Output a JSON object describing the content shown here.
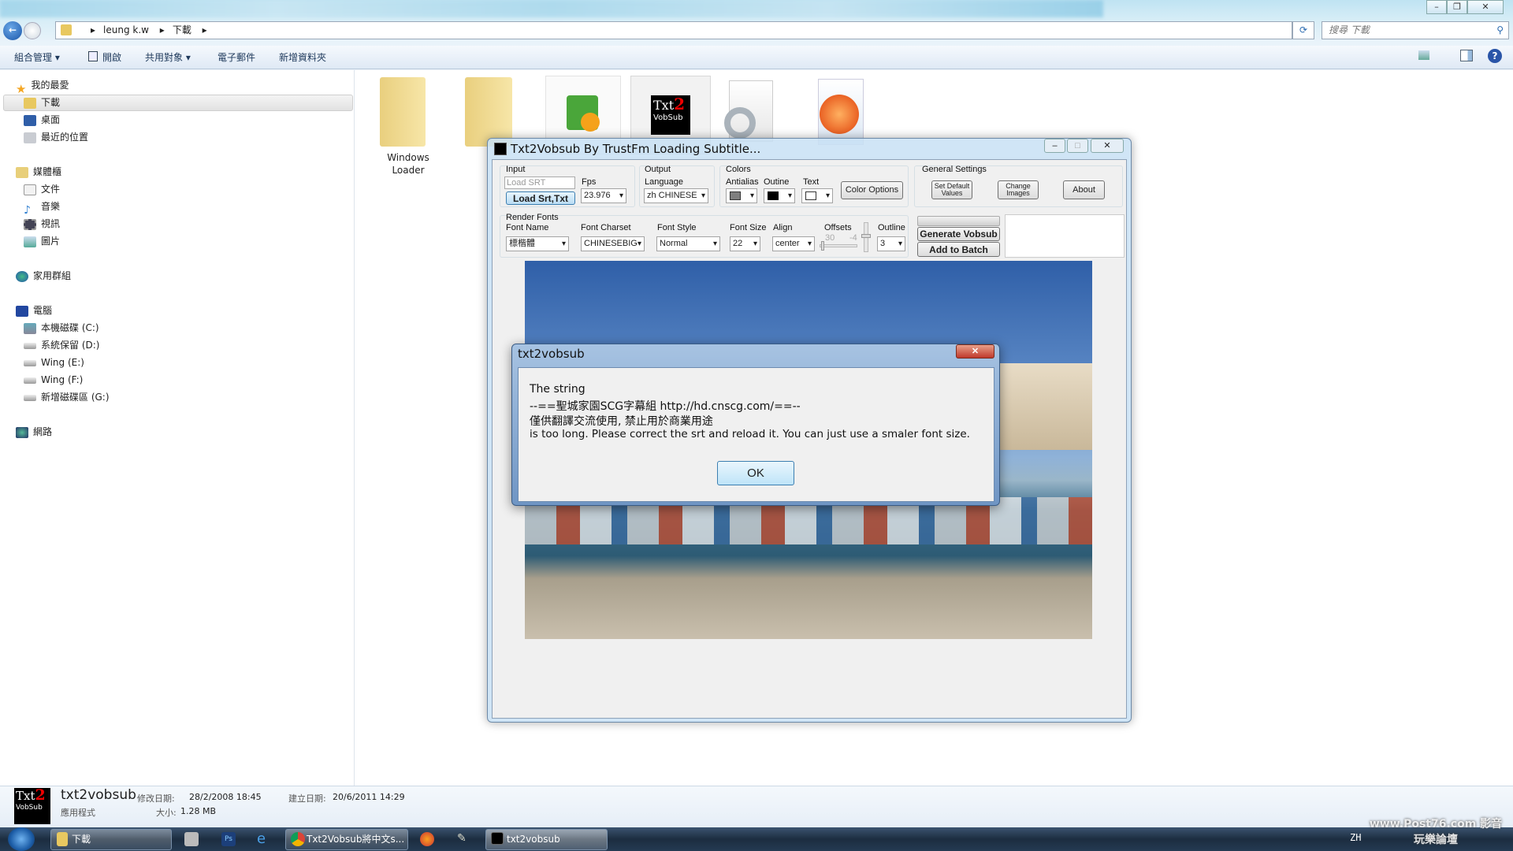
{
  "explorer": {
    "address": [
      "leung k.w",
      "下載"
    ],
    "search_placeholder": "搜尋 下載",
    "toolbar": [
      "組合管理 ▾",
      "開啟",
      "共用對象 ▾",
      "電子郵件",
      "新增資料夾"
    ],
    "sidebar": {
      "favorites": {
        "label": "我的最愛",
        "items": [
          "下載",
          "桌面",
          "最近的位置"
        ]
      },
      "libraries": {
        "label": "媒體櫃",
        "items": [
          "文件",
          "音樂",
          "視訊",
          "圖片"
        ]
      },
      "homegroup": "家用群組",
      "computer": {
        "label": "電腦",
        "items": [
          "本機磁碟 (C:)",
          "系統保留 (D:)",
          "Wing (E:)",
          "Wing (F:)",
          "新增磁碟區 (G:)"
        ]
      },
      "network": "網路"
    },
    "files": [
      {
        "label": "Windows Loader"
      }
    ],
    "details": {
      "name": "txt2vobsub",
      "type": "應用程式",
      "modified_label": "修改日期:",
      "modified": "28/2/2008 18:45",
      "created_label": "建立日期:",
      "created": "20/6/2011 14:29",
      "size_label": "大小:",
      "size": "1.28 MB"
    }
  },
  "app": {
    "title": "Txt2Vobsub By TrustFm Loading Subtitle...",
    "input": {
      "group": "Input",
      "srt_placeholder": "Load SRT",
      "load_button": "Load Srt,Txt",
      "fps_label": "Fps",
      "fps": "23.976"
    },
    "output": {
      "group": "Output",
      "language_label": "Language",
      "language": "zh CHINESE"
    },
    "colors": {
      "group": "Colors",
      "antialias": "Antialias",
      "outline": "Outine",
      "text": "Text",
      "color_options": "Color Options",
      "antialias_color": "#7f7f7f",
      "outline_color": "#000000",
      "text_color": "#ffffff"
    },
    "general": {
      "group": "General Settings",
      "set_default": "Set Default Values",
      "change_images": "Change Images",
      "about": "About"
    },
    "render": {
      "group": "Render Fonts",
      "font_name_label": "Font Name",
      "font_name": "標楷體",
      "charset_label": "Font Charset",
      "charset": "CHINESEBIG",
      "style_label": "Font Style",
      "style": "Normal",
      "size_label": "Font Size",
      "size": "22",
      "align_label": "Align",
      "align": "center",
      "offsets_label": "Offsets",
      "offset_x": "30",
      "offset_y": "-4",
      "outline_label": "Outline",
      "outline": "3"
    },
    "generate": "Generate Vobsub",
    "add_batch": "Add to Batch"
  },
  "dialog": {
    "title": "txt2vobsub",
    "lines": [
      "The string",
      "--==聖城家園SCG字幕組 http://hd.cnscg.com/==--",
      "僅供翻譯交流使用, 禁止用於商業用途",
      "is too long. Please correct the srt and reload it. You can just use a smaler font size."
    ],
    "ok": "OK"
  },
  "taskbar": {
    "explorer": "下載",
    "chrome": "Txt2Vobsub將中文s...",
    "app": "txt2vobsub",
    "lang": "ZH"
  },
  "watermark": "www.Post76.com 影音玩樂論壇"
}
